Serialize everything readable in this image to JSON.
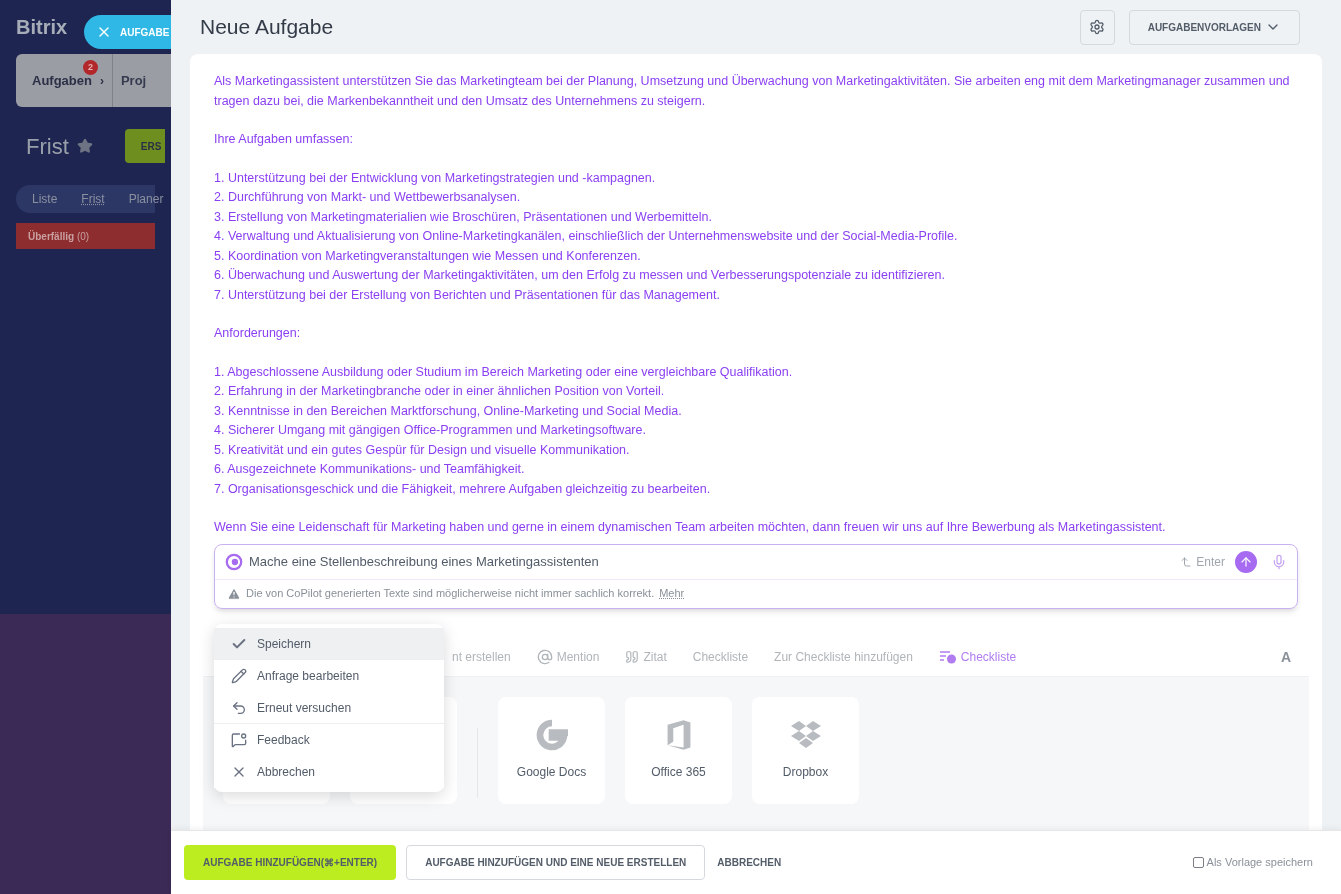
{
  "background": {
    "logo": "Bitrix",
    "close_tab": "AUFGABE",
    "nav_tabs": [
      {
        "label": "Aufgaben",
        "badge": "2",
        "chevron": "›",
        "selected": true
      },
      {
        "label": "Proj",
        "selected": false
      }
    ],
    "page_title": "Frist",
    "create_button": "ERS",
    "view_tabs": [
      {
        "label": "Liste",
        "selected": false
      },
      {
        "label": "Frist",
        "selected": true
      },
      {
        "label": "Planer",
        "selected": false
      }
    ],
    "column": {
      "title": "Überfällig",
      "count": "(0)"
    }
  },
  "header": {
    "title": "Neue Aufgabe",
    "templates_button": "AUFGABENVORLAGEN"
  },
  "content": {
    "paragraphs": [
      {
        "kind": "text",
        "text": "Als Marketingassistent unterstützen Sie das Marketingteam bei der Planung, Umsetzung und Überwachung von Marketingaktivitäten. Sie arbeiten eng mit dem Marketingmanager zusammen und tragen dazu bei, die Markenbekanntheit und den Umsatz des Unternehmens zu steigern."
      },
      {
        "kind": "text",
        "text": "Ihre Aufgaben umfassen:"
      },
      {
        "kind": "list",
        "lines": [
          "1. Unterstützung bei der Entwicklung von Marketingstrategien und -kampagnen.",
          "2. Durchführung von Markt- und Wettbewerbsanalysen.",
          "3. Erstellung von Marketingmaterialien wie Broschüren, Präsentationen und Werbemitteln.",
          "4. Verwaltung und Aktualisierung von Online-Marketingkanälen, einschließlich der Unternehmenswebsite und der Social-Media-Profile.",
          "5. Koordination von Marketingveranstaltungen wie Messen und Konferenzen.",
          "6. Überwachung und Auswertung der Marketingaktivitäten, um den Erfolg zu messen und Verbesserungspotenziale zu identifizieren.",
          "7. Unterstützung bei der Erstellung von Berichten und Präsentationen für das Management."
        ]
      },
      {
        "kind": "text",
        "text": "Anforderungen:"
      },
      {
        "kind": "list",
        "lines": [
          "1. Abgeschlossene Ausbildung oder Studium im Bereich Marketing oder eine vergleichbare Qualifikation.",
          "2. Erfahrung in der Marketingbranche oder in einer ähnlichen Position von Vorteil.",
          "3. Kenntnisse in den Bereichen Marktforschung, Online-Marketing und Social Media.",
          "4. Sicherer Umgang mit gängigen Office-Programmen und Marketingsoftware.",
          "5. Kreativität und ein gutes Gespür für Design und visuelle Kommunikation.",
          "6. Ausgezeichnete Kommunikations- und Teamfähigkeit.",
          "7. Organisationsgeschick und die Fähigkeit, mehrere Aufgaben gleichzeitig zu bearbeiten."
        ]
      },
      {
        "kind": "text",
        "text": "Wenn Sie eine Leidenschaft für Marketing haben und gerne in einem dynamischen Team arbeiten möchten, dann freuen wir uns auf Ihre Bewerbung als Marketingassistent."
      }
    ]
  },
  "copilot": {
    "value": "Mache eine Stellenbeschreibung eines Marketingassistenten",
    "enter_hint": "Enter",
    "disclaimer": "Die von CoPilot generierten Texte sind möglicherweise nicht immer sachlich korrekt.",
    "more_link": "Mehr"
  },
  "copilot_menu": [
    {
      "kind": "check",
      "label": "Speichern",
      "selected": true,
      "divider_after": true
    },
    {
      "kind": "edit",
      "label": "Anfrage bearbeiten",
      "selected": false,
      "divider_after": false
    },
    {
      "kind": "retry",
      "label": "Erneut versuchen",
      "selected": false,
      "divider_after": true
    },
    {
      "kind": "feedback",
      "label": "Feedback",
      "selected": false,
      "divider_after": false
    },
    {
      "kind": "cancel",
      "label": "Abbrechen",
      "selected": false,
      "divider_after": false
    }
  ],
  "toolbar": [
    {
      "kind": "text",
      "label": "nt erstellen"
    },
    {
      "kind": "mention",
      "label": "Mention"
    },
    {
      "kind": "quote",
      "label": "Zitat"
    },
    {
      "kind": "text",
      "label": "Checkliste"
    },
    {
      "kind": "text",
      "label": "Zur Checkliste hinzufügen"
    },
    {
      "kind": "copilot",
      "label": "Checkliste"
    }
  ],
  "format_button": "A",
  "attachments": [
    {
      "kind": "hidden"
    },
    {
      "kind": "hidden"
    },
    {
      "kind": "google",
      "label": "Google Docs"
    },
    {
      "kind": "office",
      "label": "Office 365"
    },
    {
      "kind": "dropbox",
      "label": "Dropbox"
    }
  ],
  "footer": {
    "primary": "AUFGABE HINZUFÜGEN(⌘+ENTER)",
    "secondary": "AUFGABE HINZUFÜGEN UND EINE NEUE ERSTELLEN",
    "cancel": "ABBRECHEN",
    "save_template": {
      "label": "Als Vorlage speichern",
      "checked": false
    }
  }
}
